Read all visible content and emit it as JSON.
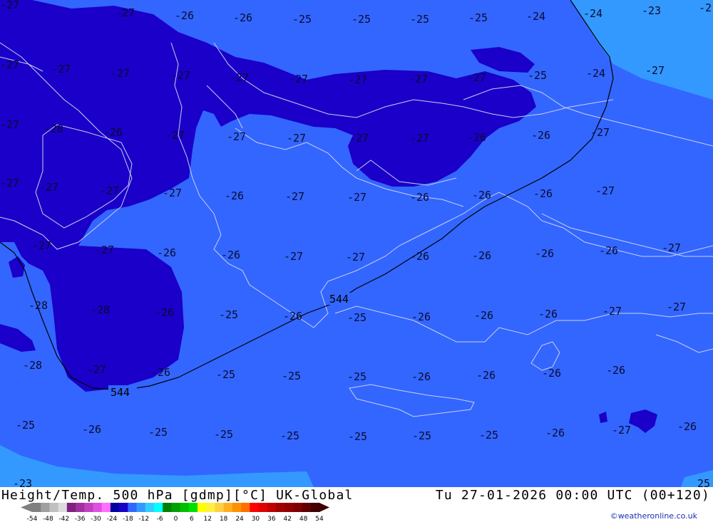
{
  "map": {
    "colors": {
      "band_minus25": "#3366ff",
      "band_minus27": "#1a00c8",
      "band_minus23": "#3399ff",
      "coast": "#c8d0f0",
      "contour": "#000000"
    },
    "contour_labels": [
      "544",
      "544"
    ],
    "value_labels": [
      "-27",
      "-27",
      "-26",
      "-26",
      "-25",
      "-25",
      "-25",
      "-25",
      "-24",
      "-24",
      "-23",
      "-2",
      "-27",
      "-27",
      "-27",
      "-27",
      "-27",
      "-27",
      "-27",
      "-27",
      "-27",
      "-25",
      "-24",
      "-27",
      "-27",
      "-28",
      "-26",
      "-27",
      "-27",
      "-27",
      "-27",
      "-27",
      "-26",
      "-26",
      "-27",
      "-27",
      "-27",
      "-27",
      "-27",
      "-26",
      "-27",
      "-27",
      "-26",
      "-26",
      "-26",
      "-27",
      "-27",
      "-27",
      "-26",
      "-26",
      "-27",
      "-27",
      "-26",
      "-26",
      "-26",
      "-26",
      "-27",
      "-28",
      "-28",
      "-26",
      "-25",
      "-26",
      "-25",
      "-26",
      "-26",
      "-26",
      "-27",
      "-27",
      "-28",
      "-27",
      "-26",
      "-25",
      "-25",
      "-25",
      "-26",
      "-26",
      "-26",
      "-26",
      "-25",
      "-26",
      "-25",
      "-25",
      "-25",
      "-25",
      "-25",
      "-25",
      "-26",
      "-27",
      "-26",
      "-23",
      "25"
    ]
  },
  "footer": {
    "title": "Height/Temp. 500 hPa [gdmp][°C] UK-Global",
    "valid": "Tu 27-01-2026 00:00 UTC (00+120)",
    "credit": "©weatheronline.co.uk",
    "colorbar": {
      "ticks": [
        "-54",
        "-48",
        "-42",
        "-36",
        "-30",
        "-24",
        "-18",
        "-12",
        "-6",
        "0",
        "6",
        "12",
        "18",
        "24",
        "30",
        "36",
        "42",
        "48",
        "54"
      ],
      "colors": [
        "#808080",
        "#a0a0a0",
        "#c0c0c0",
        "#dcdcdc",
        "#802080",
        "#a030a0",
        "#c040c0",
        "#e050e0",
        "#ff70ff",
        "#0000a0",
        "#1a00c8",
        "#3366ff",
        "#3399ff",
        "#33ccff",
        "#00ffff",
        "#008000",
        "#00a000",
        "#00c000",
        "#00e000",
        "#ffff00",
        "#fff040",
        "#ffd040",
        "#ffb020",
        "#ff9000",
        "#ff7000",
        "#ff0000",
        "#e00000",
        "#c00000",
        "#a00000",
        "#900000",
        "#800000",
        "#600000",
        "#400000"
      ]
    }
  }
}
